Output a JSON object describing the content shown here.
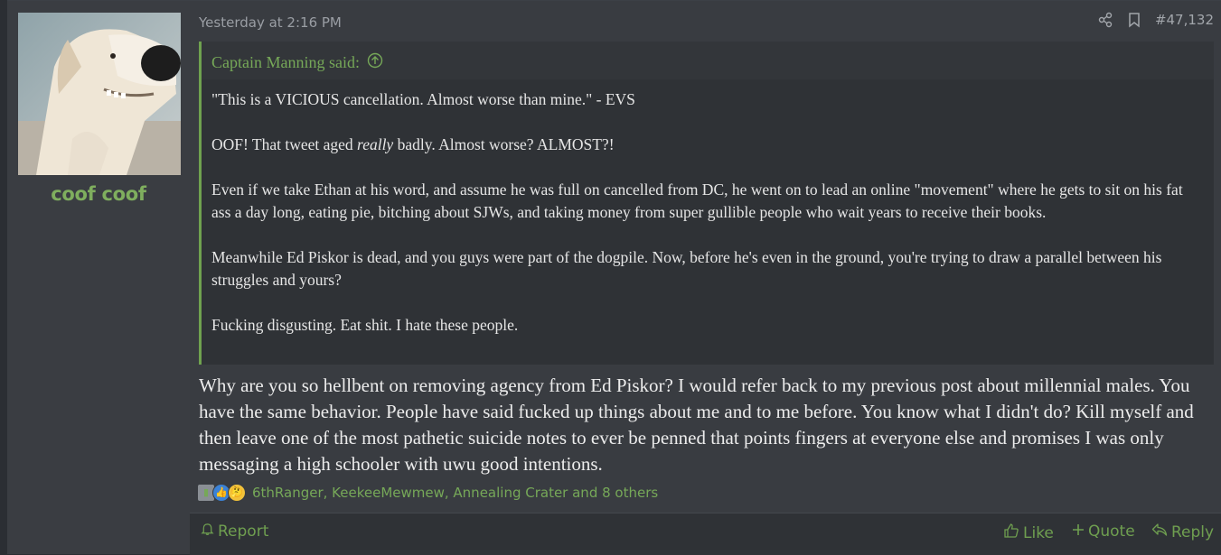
{
  "user": {
    "name": "coof coof"
  },
  "post": {
    "date": "Yesterday at 2:16 PM",
    "number": "#47,132"
  },
  "quote": {
    "author": "Captain Manning said:",
    "paragraphs": [
      "\"This is a VICIOUS cancellation. Almost worse than mine.\" - EVS",
      "badly. Almost worse? ALMOST?!",
      "Even if we take Ethan at his word, and assume he was full on cancelled from DC, he went on to lead an online \"movement\" where he gets to sit on his fat ass a day long, eating pie, bitching about SJWs, and taking money from super gullible people who wait years to receive their books.",
      "Meanwhile Ed Piskor is dead, and you guys were part of the dogpile. Now, before he's even in the ground, you're trying to draw a parallel between his struggles and yours?",
      "Fucking disgusting. Eat shit. I hate these people."
    ],
    "p2_prefix": "OOF! That tweet aged ",
    "p2_emphasis": "really"
  },
  "body": {
    "text": "Why are you so hellbent on removing agency from Ed Piskor? I would refer back to my previous post about millennial males. You have the same behavior. People have said fucked up things about me and to me before. You know what I didn't do? Kill myself and then leave one of the most pathetic suicide notes to ever be penned that points fingers at everyone else and promises I was only messaging a high schooler with uwu good intentions."
  },
  "reactions": {
    "text": "6thRanger, KeekeeMewmew, Annealing Crater and 8 others"
  },
  "footer": {
    "report": "Report",
    "like": "Like",
    "quote": "Quote",
    "reply": "Reply"
  },
  "colors": {
    "accent_green": "#6f9f50",
    "username_green": "#7fae5e"
  }
}
